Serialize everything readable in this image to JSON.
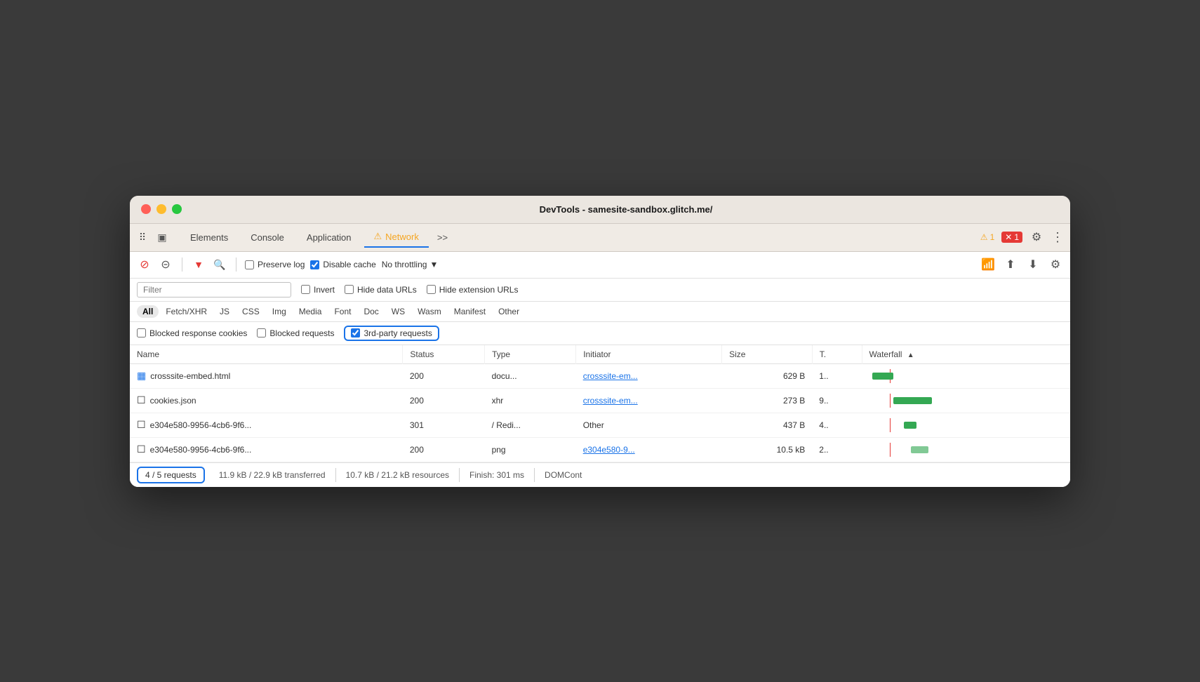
{
  "window": {
    "title": "DevTools - samesite-sandbox.glitch.me/"
  },
  "tabs": [
    {
      "id": "elements",
      "label": "Elements",
      "active": false
    },
    {
      "id": "console",
      "label": "Console",
      "active": false
    },
    {
      "id": "application",
      "label": "Application",
      "active": false
    },
    {
      "id": "network",
      "label": "Network",
      "active": true,
      "hasWarning": true
    },
    {
      "id": "more",
      "label": ">>",
      "active": false
    }
  ],
  "toolbar": {
    "preserveLog": "Preserve log",
    "disableCache": "Disable cache",
    "throttling": "No throttling"
  },
  "filterBar": {
    "placeholder": "Filter",
    "invert": "Invert",
    "hideDataURLs": "Hide data URLs",
    "hideExtensionURLs": "Hide extension URLs"
  },
  "typeFilters": [
    "All",
    "Fetch/XHR",
    "JS",
    "CSS",
    "Img",
    "Media",
    "Font",
    "Doc",
    "WS",
    "Wasm",
    "Manifest",
    "Other"
  ],
  "cookieFilters": {
    "blockedResponseCookies": "Blocked response cookies",
    "blockedRequests": "Blocked requests",
    "thirdPartyRequests": "3rd-party requests"
  },
  "tableColumns": [
    "Name",
    "Status",
    "Type",
    "Initiator",
    "Size",
    "T.",
    "Waterfall"
  ],
  "rows": [
    {
      "name": "crosssite-embed.html",
      "status": "200",
      "type": "docu...",
      "initiator": "crosssite-em...",
      "size": "629 B",
      "time": "1..",
      "isDoc": true,
      "wfLeft": 5,
      "wfWidth": 30,
      "wfColor": "wf-green"
    },
    {
      "name": "cookies.json",
      "status": "200",
      "type": "xhr",
      "initiator": "crosssite-em...",
      "size": "273 B",
      "time": "9..",
      "isDoc": false,
      "wfLeft": 35,
      "wfWidth": 55,
      "wfColor": "wf-green"
    },
    {
      "name": "e304e580-9956-4cb6-9f6...",
      "status": "301",
      "type": "/ Redi...",
      "initiator": "Other",
      "size": "437 B",
      "time": "4..",
      "isDoc": false,
      "wfLeft": 50,
      "wfWidth": 18,
      "wfColor": "wf-green"
    },
    {
      "name": "e304e580-9956-4cb6-9f6...",
      "status": "200",
      "type": "png",
      "initiator": "e304e580-9...",
      "size": "10.5 kB",
      "time": "2..",
      "isDoc": false,
      "wfLeft": 60,
      "wfWidth": 25,
      "wfColor": "wf-light-green"
    }
  ],
  "statusBar": {
    "requests": "4 / 5 requests",
    "transferred": "11.9 kB / 22.9 kB transferred",
    "resources": "10.7 kB / 21.2 kB resources",
    "finish": "Finish: 301 ms",
    "domContent": "DOMCont"
  },
  "warnings": {
    "count": "1",
    "errors": "1"
  }
}
